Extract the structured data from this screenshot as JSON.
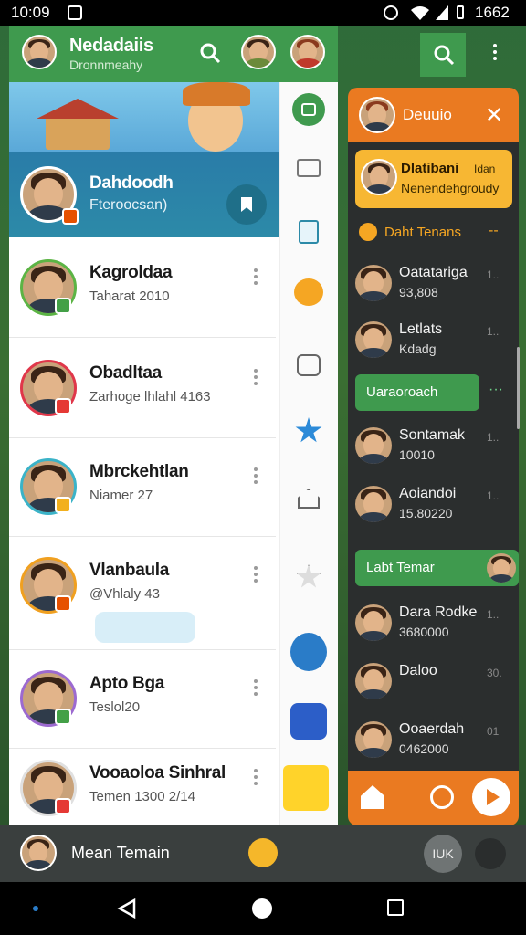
{
  "status_bar": {
    "time": "10:09",
    "battery": "1662"
  },
  "header": {
    "title": "Nedadaiis",
    "subtitle": "Dronnmeahy"
  },
  "banner": {
    "title": "Dahdoodh",
    "subtitle": "Fteroocsan)"
  },
  "chats": [
    {
      "name": "Kagroldaa",
      "preview": "Taharat 2010",
      "ring": "#5cb445",
      "badge": "#43a047"
    },
    {
      "name": "Obadltaa",
      "preview": "Zarhoge lhlahl 4163",
      "ring": "#e0374a",
      "badge": "#e53935"
    },
    {
      "name": "Mbrckehtlan",
      "preview": "Niamer 27",
      "ring": "#3bb3c8",
      "badge": "#f2b01e"
    },
    {
      "name": "Vlanbaula",
      "preview": "@Vhlaly 43",
      "ring": "#f0a020",
      "badge": "#e65100"
    },
    {
      "name": "Apto Bga",
      "preview": "Teslol20",
      "ring": "#9c6ad0",
      "badge": "#43a047"
    },
    {
      "name": "Vooaoloa Sinhral",
      "preview": "Temen 1300 2/14",
      "ring": "#e0e0e0",
      "badge": "#e53935"
    }
  ],
  "right_panel": {
    "header_label": "Deuuio",
    "featured": {
      "name": "Dlatibani",
      "preview": "Nenendehgroudy",
      "tag": "Idan"
    },
    "section1": "Daht Tenans",
    "items1": [
      {
        "name": "Oatatariga",
        "preview": "93,808",
        "num": "1.."
      },
      {
        "name": "Letlats",
        "preview": "Kdadg",
        "num": "1.."
      }
    ],
    "pill": "Uaraoroach",
    "items2": [
      {
        "name": "Sontamak",
        "preview": "10010",
        "num": "1.."
      },
      {
        "name": "Aoiandoi",
        "preview": "15.80220",
        "num": "1.."
      }
    ],
    "section2": "Labt Temar",
    "items3": [
      {
        "name": "Dara Rodke",
        "preview": "3680000",
        "num": "1.."
      },
      {
        "name": "Daloo",
        "preview": "",
        "num": "30."
      },
      {
        "name": "Ooaerdah",
        "preview": "0462000",
        "num": "01"
      }
    ]
  },
  "bottom": {
    "user": "Mean Temain",
    "round_label": "IUK"
  },
  "colors": {
    "green": "#3f9a4e",
    "orange": "#ea7a21",
    "teal": "#2c8aa8",
    "dark_panel": "#2b2e2e"
  }
}
